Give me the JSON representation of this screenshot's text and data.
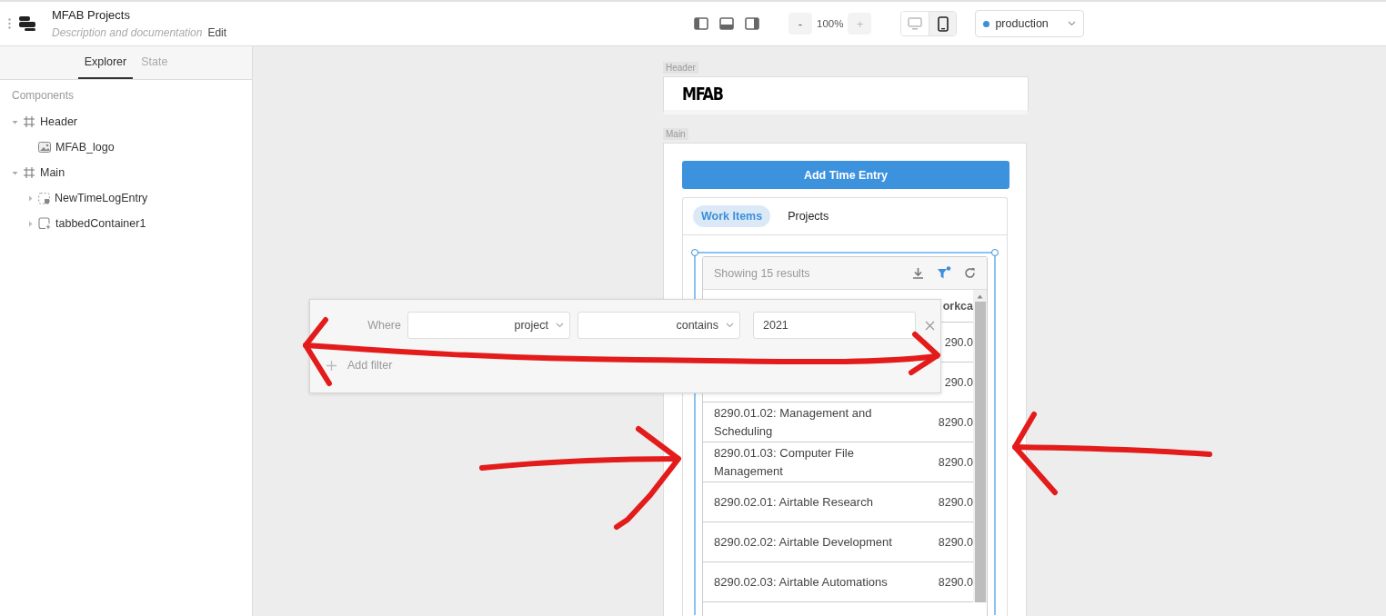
{
  "app": {
    "title": "MFAB Projects",
    "description": "Description and documentation",
    "edit_label": "Edit"
  },
  "toolbar": {
    "zoom_out": "-",
    "zoom": "100%",
    "zoom_in": "+",
    "devices": [
      {
        "kind": "desktop",
        "selected": false
      },
      {
        "kind": "mobile",
        "selected": true
      }
    ],
    "environment": "production"
  },
  "sidebar": {
    "tabs": [
      {
        "label": "Explorer",
        "selected": true
      },
      {
        "label": "State",
        "selected": false
      }
    ],
    "section": "Components",
    "tree": [
      {
        "label": "Header",
        "kind": "frame",
        "expanded": true,
        "children": [
          {
            "label": "MFAB_logo",
            "kind": "image"
          }
        ]
      },
      {
        "label": "Main",
        "kind": "frame",
        "expanded": true,
        "children": [
          {
            "label": "NewTimeLogEntry",
            "kind": "module",
            "expanded": false
          },
          {
            "label": "tabbedContainer1",
            "kind": "container",
            "expanded": false
          }
        ]
      }
    ]
  },
  "canvas": {
    "header_label": "Header",
    "logo": "MFAB",
    "main_label": "Main",
    "button": "Add Time Entry",
    "tabs": [
      {
        "label": "Work Items",
        "selected": true
      },
      {
        "label": "Projects",
        "selected": false
      }
    ],
    "table": {
      "summary": "Showing 15 results",
      "filter_active": true,
      "column_2": "orkca",
      "rows": [
        {
          "column_2": "290.0"
        },
        {
          "column_2": "290.0"
        },
        {
          "column_1": "8290.01.02: Management and Scheduling",
          "column_2": "8290.0"
        },
        {
          "column_1": "8290.01.03: Computer File Management",
          "column_2": "8290.0"
        },
        {
          "column_1": "8290.02.01: Airtable Research",
          "column_2": "8290.0"
        },
        {
          "column_1": "8290.02.02: Airtable Development",
          "column_2": "8290.0"
        },
        {
          "column_1": "8290.02.03: Airtable Automations",
          "column_2": "8290.0"
        }
      ]
    }
  },
  "filter_popup": {
    "where": "Where",
    "field": "project",
    "operator": "contains",
    "value": "2021",
    "add": "Add filter"
  }
}
